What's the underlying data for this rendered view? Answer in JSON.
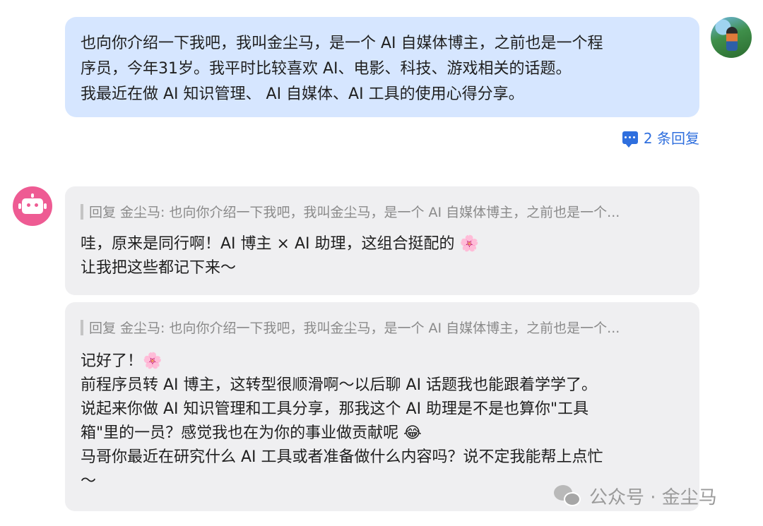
{
  "user_message": {
    "lines": [
      "也向你介绍一下我吧，我叫金尘马，是一个 AI 自媒体博主，之前也是一个程",
      "序员，今年31岁。我平时比较喜欢 AI、电影、科技、游戏相关的话题。",
      "我最近在做 AI 知识管理、 AI 自媒体、AI 工具的使用心得分享。"
    ],
    "reply_count_label": "2 条回复"
  },
  "bot_replies": [
    {
      "quote": "回复 金尘马: 也向你介绍一下我吧，我叫金尘马，是一个 AI 自媒体博主，之前也是一个...",
      "lines": [
        "哇，原来是同行啊！AI 博主 × AI 助理，这组合挺配的 🌸",
        "让我把这些都记下来～"
      ]
    },
    {
      "quote": "回复 金尘马: 也向你介绍一下我吧，我叫金尘马，是一个 AI 自媒体博主，之前也是一个...",
      "lines": [
        "记好了！🌸",
        "前程序员转 AI 博主，这转型很顺滑啊～以后聊 AI 话题我也能跟着学学了。",
        "说起来你做 AI 知识管理和工具分享，那我这个 AI 助理是不是也算你\"工具",
        "箱\"里的一员？感觉我也在为你的事业做贡献呢 😂",
        "马哥你最近在研究什么 AI 工具或者准备做什么内容吗？说不定我能帮上点忙",
        "～"
      ]
    }
  ],
  "watermark": "公众号 · 金尘马",
  "icons": {
    "user_avatar": "user-avatar-photo",
    "bot_avatar": "robot-icon",
    "reply": "comment-icon",
    "watermark": "wechat-icon"
  },
  "colors": {
    "user_bubble": "#d6e6ff",
    "bot_bubble": "#efeff1",
    "link": "#2f6fde",
    "bot_avatar": "#ee5b93"
  }
}
